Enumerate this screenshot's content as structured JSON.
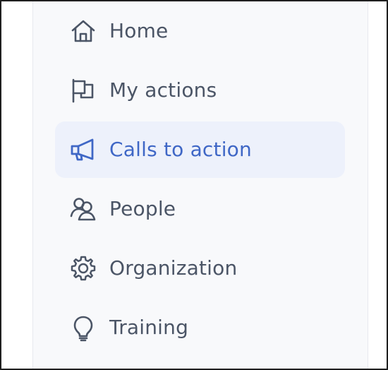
{
  "nav": {
    "items": [
      {
        "label": "Home",
        "icon": "home-icon",
        "active": false
      },
      {
        "label": "My actions",
        "icon": "flag-icon",
        "active": false
      },
      {
        "label": "Calls to action",
        "icon": "megaphone-icon",
        "active": true
      },
      {
        "label": "People",
        "icon": "people-icon",
        "active": false
      },
      {
        "label": "Organization",
        "icon": "gear-icon",
        "active": false
      },
      {
        "label": "Training",
        "icon": "lightbulb-icon",
        "active": false
      }
    ]
  },
  "colors": {
    "text": "#4b5566",
    "active_text": "#3f67c6",
    "active_bg": "#edf1fb",
    "panel_bg": "#f8f9fb"
  }
}
